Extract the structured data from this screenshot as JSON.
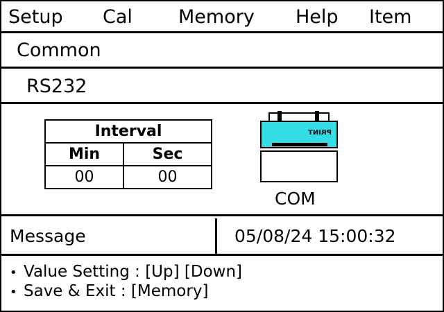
{
  "menu": {
    "items": [
      "Setup",
      "Cal",
      "Memory",
      "Help",
      "Item"
    ]
  },
  "section": {
    "title": "Common"
  },
  "subsection": {
    "title": "RS232"
  },
  "interval": {
    "header": "Interval",
    "columns": [
      "Min",
      "Sec"
    ],
    "values": [
      "00",
      "00"
    ]
  },
  "device": {
    "printer_label": "PRINT",
    "port_label": "COM",
    "accent_color": "#33dde6"
  },
  "status": {
    "message_label": "Message",
    "datetime": "05/08/24 15:00:32"
  },
  "help": {
    "lines": [
      {
        "bullet": "•",
        "text": "Value Setting : [Up] [Down]"
      },
      {
        "bullet": "•",
        "text": "Save & Exit : [Memory]"
      }
    ]
  }
}
